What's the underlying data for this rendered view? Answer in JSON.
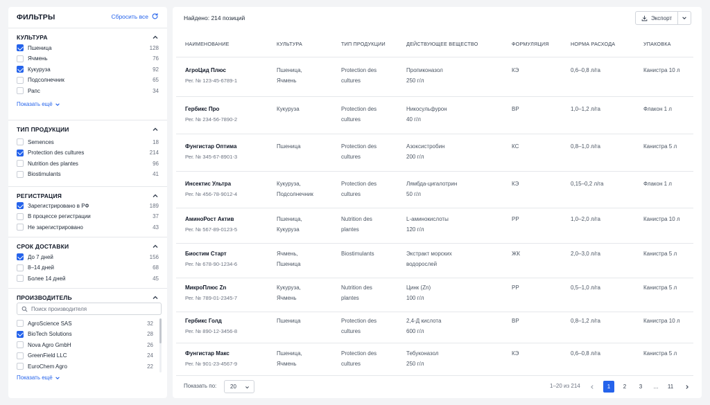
{
  "sidebar": {
    "title": "ФИЛЬТРЫ",
    "reset_label": "Сбросить все",
    "sections": {
      "culture": {
        "title": "КУЛЬТУРА",
        "options": [
          {
            "label": "Пшеница",
            "count": "128",
            "checked": true
          },
          {
            "label": "Ячмень",
            "count": "76",
            "checked": false
          },
          {
            "label": "Кукуруза",
            "count": "92",
            "checked": true
          },
          {
            "label": "Подсолнечник",
            "count": "65",
            "checked": false
          },
          {
            "label": "Рапс",
            "count": "34",
            "checked": false
          }
        ],
        "show_more": "Показать ещё"
      },
      "product_type": {
        "title": "ТИП ПРОДУКЦИИ",
        "options": [
          {
            "label": "Semences",
            "count": "18",
            "checked": false
          },
          {
            "label": "Protection des cultures",
            "count": "214",
            "checked": true
          },
          {
            "label": "Nutrition des plantes",
            "count": "96",
            "checked": false
          },
          {
            "label": "Biostimulants",
            "count": "41",
            "checked": false
          }
        ]
      },
      "registration": {
        "title": "РЕГИСТРАЦИЯ",
        "options": [
          {
            "label": "Зарегистрировано в РФ",
            "count": "189",
            "checked": true
          },
          {
            "label": "В процессе регистрации",
            "count": "37",
            "checked": false
          },
          {
            "label": "Не зарегистрировано",
            "count": "43",
            "checked": false
          }
        ]
      },
      "delivery": {
        "title": "СРОК ДОСТАВКИ",
        "options": [
          {
            "label": "До 7 дней",
            "count": "156",
            "checked": true
          },
          {
            "label": "8–14 дней",
            "count": "68",
            "checked": false
          },
          {
            "label": "Более 14 дней",
            "count": "45",
            "checked": false
          }
        ]
      },
      "manufacturer": {
        "title": "ПРОИЗВОДИТЕЛЬ",
        "search_placeholder": "Поиск производителя",
        "options": [
          {
            "label": "AgroScience SAS",
            "count": "32",
            "checked": false
          },
          {
            "label": "BioTech Solutions",
            "count": "28",
            "checked": true
          },
          {
            "label": "Nova Agro GmbH",
            "count": "26",
            "checked": false
          },
          {
            "label": "GreenField LLC",
            "count": "24",
            "checked": false
          },
          {
            "label": "EuroChem Agro",
            "count": "22",
            "checked": false
          }
        ],
        "show_more": "Показать ещё"
      }
    }
  },
  "main": {
    "found": "Найдено: 214 позиций",
    "export_label": "Экспорт",
    "columns": [
      "НАИМЕНОВАНИЕ",
      "КУЛЬТУРА",
      "ТИП ПРОДУКЦИИ",
      "ДЕЙСТВУЮЩЕЕ ВЕЩЕСТВО",
      "ФОРМУЛЯЦИЯ",
      "НОРМА РАСХОДА",
      "УПАКОВКА"
    ],
    "rows": [
      {
        "name": "АгроЦид Плюс",
        "reg": "Рег. № 123-45-6789-1",
        "culture": [
          "Пшеница,",
          "Ячмень"
        ],
        "type": [
          "Protection des",
          "cultures"
        ],
        "substance": [
          "Пропиконазол",
          "250 г/л"
        ],
        "form": "КЭ",
        "rate": "0,6–0,8 л/га",
        "pack": "Канистра 10 л"
      },
      {
        "name": "Гербикс Про",
        "reg": "Рег. № 234-56-7890-2",
        "culture": [
          "Кукуруза"
        ],
        "type": [
          "Protection des",
          "cultures"
        ],
        "substance": [
          "Никосульфурон",
          "40 г/л"
        ],
        "form": "ВР",
        "rate": "1,0–1,2 л/га",
        "pack": "Флакон 1 л"
      },
      {
        "name": "Фунгистар Оптима",
        "reg": "Рег. № 345-67-8901-3",
        "culture": [
          "Пшеница"
        ],
        "type": [
          "Protection des",
          "cultures"
        ],
        "substance": [
          "Азоксистробин",
          "200 г/л"
        ],
        "form": "КС",
        "rate": "0,8–1,0 л/га",
        "pack": "Канистра 5 л"
      },
      {
        "name": "Инсектис Ультра",
        "reg": "Рег. № 456-78-9012-4",
        "culture": [
          "Кукуруза,",
          "Подсолнечник"
        ],
        "type": [
          "Protection des",
          "cultures"
        ],
        "substance": [
          "Лямбда-цигалотрин",
          "50 г/л"
        ],
        "form": "КЭ",
        "rate": "0,15–0,2 л/га",
        "pack": "Флакон 1 л"
      },
      {
        "name": "АминоРост Актив",
        "reg": "Рег. № 567-89-0123-5",
        "culture": [
          "Пшеница,",
          "Кукуруза"
        ],
        "type": [
          "Nutrition des",
          "plantes"
        ],
        "substance": [
          "L-аминокислоты",
          "120 г/л"
        ],
        "form": "РР",
        "rate": "1,0–2,0 л/га",
        "pack": "Канистра 10 л"
      },
      {
        "name": "Биостим Старт",
        "reg": "Рег. № 678-90-1234-6",
        "culture": [
          "Ячмень,",
          "Пшеница"
        ],
        "type": [
          "Biostimulants"
        ],
        "substance": [
          "Экстракт морских",
          "водорослей"
        ],
        "form": "ЖК",
        "rate": "2,0–3,0 л/га",
        "pack": "Канистра 5 л"
      },
      {
        "name": "МикроПлюс Zn",
        "reg": "Рег. № 789-01-2345-7",
        "culture": [
          "Кукуруза,",
          "Ячмень"
        ],
        "type": [
          "Nutrition des",
          "plantes"
        ],
        "substance": [
          "Цинк (Zn)",
          "100 г/л"
        ],
        "form": "РР",
        "rate": "0,5–1,0 л/га",
        "pack": "Канистра 5 л"
      },
      {
        "name": "Гербикс Голд",
        "reg": "Рег. № 890-12-3456-8",
        "culture": [
          "Пшеница"
        ],
        "type": [
          "Protection des",
          "cultures"
        ],
        "substance": [
          "2,4-Д кислота",
          "600 г/л"
        ],
        "form": "ВР",
        "rate": "0,8–1,2 л/га",
        "pack": "Канистра 10 л"
      },
      {
        "name": "Фунгистар Макс",
        "reg": "Рег. № 901-23-4567-9",
        "culture": [
          "Пшеница,",
          "Ячмень"
        ],
        "type": [
          "Protection des",
          "cultures"
        ],
        "substance": [
          "Тебуконазол",
          "250 г/л"
        ],
        "form": "КЭ",
        "rate": "0,6–0,8 л/га",
        "pack": "Канистра 5 л"
      }
    ],
    "footer": {
      "show_by": "Показать по:",
      "page_size": "20",
      "range": "1–20 из 214",
      "pages": [
        "1",
        "2",
        "3",
        "...",
        "11"
      ],
      "active_page": "1"
    }
  },
  "colors": {
    "accent": "#2563eb",
    "border": "#e5e7eb",
    "background": "#f3f4f6"
  }
}
